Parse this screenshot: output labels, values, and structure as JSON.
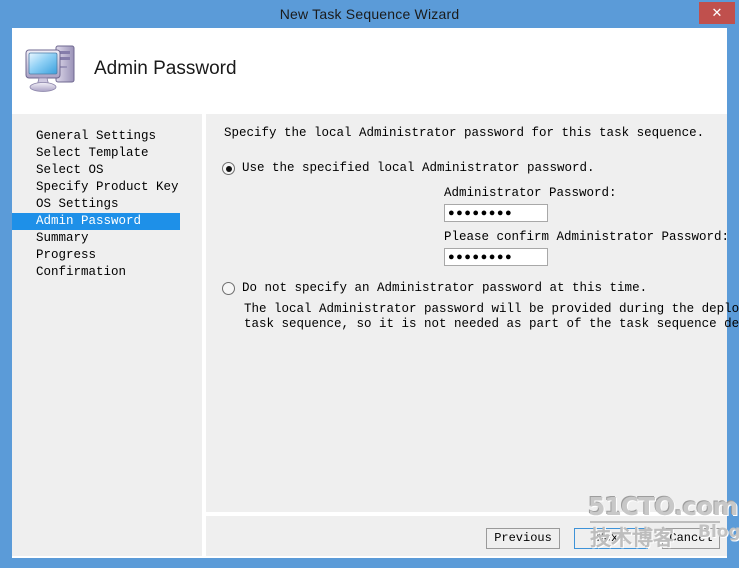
{
  "window": {
    "title": "New Task Sequence Wizard",
    "close_label": "✕",
    "titlebar_color": "#5b9bd8",
    "close_color": "#c0504d"
  },
  "header": {
    "page_title": "Admin Password",
    "icon": "computer-icon"
  },
  "sidebar": {
    "selected_color": "#1e90e8",
    "items": [
      {
        "label": "General Settings",
        "selected": false
      },
      {
        "label": "Select Template",
        "selected": false
      },
      {
        "label": "Select OS",
        "selected": false
      },
      {
        "label": "Specify Product Key",
        "selected": false
      },
      {
        "label": "OS Settings",
        "selected": false
      },
      {
        "label": "Admin Password",
        "selected": true
      },
      {
        "label": "Summary",
        "selected": false
      },
      {
        "label": "Progress",
        "selected": false
      },
      {
        "label": "Confirmation",
        "selected": false
      }
    ]
  },
  "content": {
    "intro": "Specify the local Administrator password for this task sequence.",
    "option_specify": {
      "label": "Use the specified local Administrator password.",
      "checked": true,
      "password_label": "Administrator Password:",
      "password_value": "●●●●●●●●",
      "password_placeholder": "",
      "confirm_label": "Please confirm Administrator Password:",
      "confirm_value": "●●●●●●●●",
      "confirm_placeholder": ""
    },
    "option_skip": {
      "label": "Do not specify an Administrator password at this time.",
      "checked": false,
      "description_line1": "The local Administrator password will be provided during the deployment of this",
      "description_line2": "task sequence, so it is not needed as part of the task sequence definition."
    }
  },
  "footer": {
    "previous_label": "Previous",
    "next_label": "Next",
    "cancel_label": "Cancel"
  },
  "watermark": {
    "main": "51CTO.com",
    "sub": "技术博客",
    "blog": "Blog"
  }
}
